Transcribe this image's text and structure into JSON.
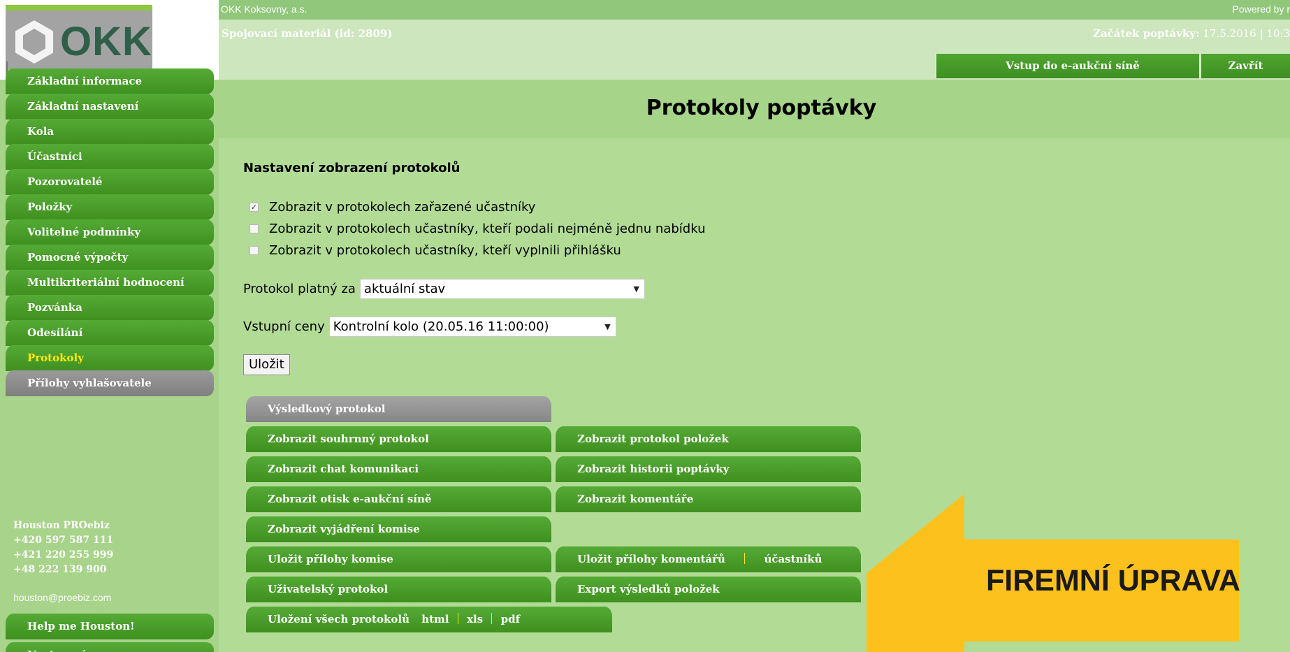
{
  "header": {
    "logo_text": "OKK",
    "company": "OKK Koksovny, a.s.",
    "powered_by": "Powered by r",
    "tender_title": "Spojovací materiál  (id: 2809)",
    "start_label": "Začátek poptávky:",
    "start_value": " 17.5.2016 | 10:3",
    "enter_auction_label": "Vstup do e-aukční síně",
    "close_label": "Zavřít"
  },
  "sidebar": {
    "items": [
      {
        "label": "Základní informace"
      },
      {
        "label": "Základní nastavení"
      },
      {
        "label": "Kola"
      },
      {
        "label": "Účastníci"
      },
      {
        "label": "Pozorovatelé"
      },
      {
        "label": "Položky"
      },
      {
        "label": "Volitelné podmínky"
      },
      {
        "label": "Pomocné výpočty"
      },
      {
        "label": "Multikriteriální hodnocení"
      },
      {
        "label": "Pozvánka"
      },
      {
        "label": "Odesílání"
      },
      {
        "label": "Protokoly"
      },
      {
        "label": "Přílohy vyhlašovatele"
      }
    ],
    "active_item": "Protokoly",
    "contact": {
      "name": "Houston PROebiz",
      "phone_cz": "+420 597 587 111",
      "phone_sk": "+421 220 255 999",
      "phone_pl": "+48 222 139 900",
      "email": "houston@proebiz.com"
    },
    "help_label": "Help me Houston!",
    "bottom_item_label": "Nastavení"
  },
  "main": {
    "page_title": "Protokoly poptávky",
    "settings_title": "Nastavení zobrazení protokolů",
    "checkboxes": [
      {
        "label": "Zobrazit v protokolech zařazené učastníky",
        "checked": true
      },
      {
        "label": "Zobrazit v protokolech učastníky, kteří podali nejméně jednu nabídku",
        "checked": false
      },
      {
        "label": "Zobrazit v protokolech učastníky, kteří vyplnili přihlášku",
        "checked": false
      }
    ],
    "valid_for_label": "Protokol platný za",
    "valid_for_value": "aktuální stav",
    "input_prices_label": "Vstupní ceny",
    "input_prices_value": "Kontrolní kolo (20.05.16 11:00:00)",
    "save_label": "Uložit",
    "result_protocol_label": "Výsledkový protokol",
    "buttons": {
      "summary": "Zobrazit souhrnný protokol",
      "items": "Zobrazit protokol položek",
      "chat": "Zobrazit chat komunikaci",
      "history": "Zobrazit historii poptávky",
      "auction_print": "Zobrazit otisk e-aukční síně",
      "comments": "Zobrazit komentáře",
      "committee_statement": "Zobrazit vyjádření komise",
      "save_committee_attachments": "Uložit přílohy komise",
      "save_comment_attachments": "Uložit přílohy komentářů",
      "participants": "účastníků",
      "user_protocol": "Uživatelský protokol",
      "export_item_results": "Export výsledků položek",
      "save_all": "Uložení všech protokolů",
      "html": "html",
      "xls": "xls",
      "pdf": "pdf"
    },
    "promo_text": "FIREMNÍ ÚPRAVA"
  },
  "colors": {
    "page_bg": "#b2dc96",
    "button_green": "#4a9e2c",
    "button_grey": "#8f8f8f",
    "active_text": "#ffe810",
    "promo_arrow": "#fcc11d"
  },
  "icons": [
    "hexagon-logo-icon",
    "checkbox-checked-icon",
    "dropdown-arrow-icon"
  ]
}
